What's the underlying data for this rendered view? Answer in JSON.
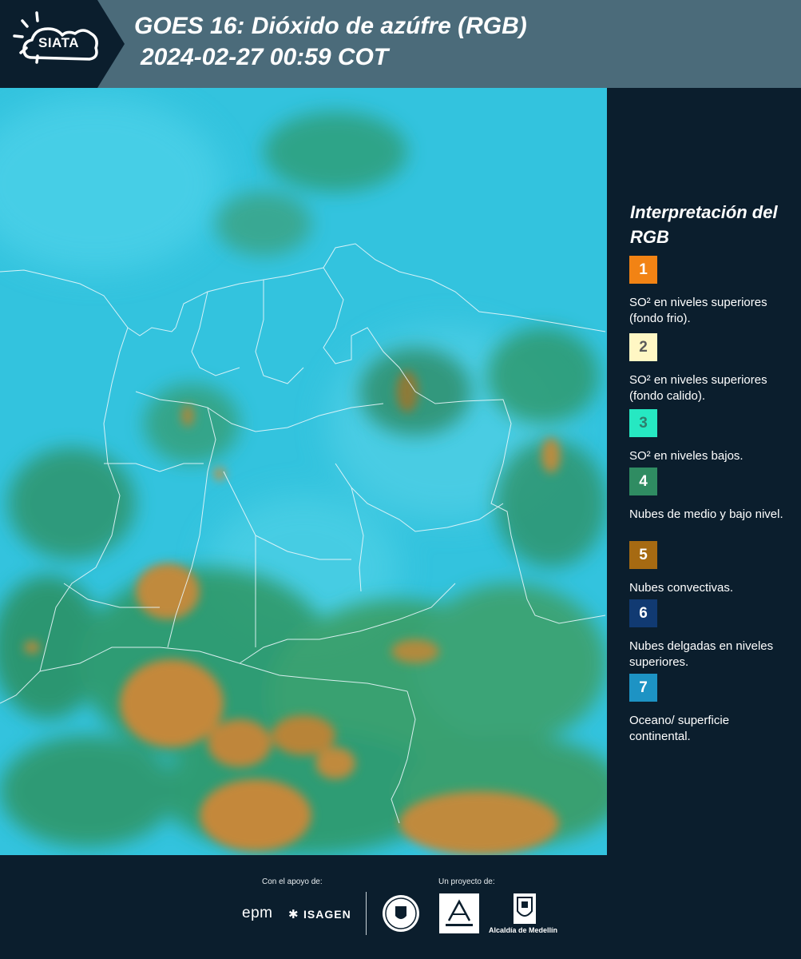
{
  "header": {
    "logo_text": "SIATA",
    "title_line1": "GOES 16: Dióxido de azúfre (RGB)",
    "title_line2": "2024-02-27 00:59 COT"
  },
  "legend": {
    "title": "Interpretación del RGB",
    "items": [
      {
        "number": "1",
        "label": "SO² en niveles superiores (fondo frio).",
        "color": "#f28314",
        "text_color": "#ffffff"
      },
      {
        "number": "2",
        "label": "SO² en niveles superiores (fondo calido).",
        "color": "#fff7c4",
        "text_color": "#5a5a5a"
      },
      {
        "number": "3",
        "label": "SO² en niveles bajos.",
        "color": "#26e8c2",
        "text_color": "#2f7c6c"
      },
      {
        "number": "4",
        "label": "Nubes de medio y bajo nivel.",
        "color": "#2f8c62",
        "text_color": "#ffffff"
      },
      {
        "number": "5",
        "label": "Nubes convectivas.",
        "color": "#a66a12",
        "text_color": "#ffffff"
      },
      {
        "number": "6",
        "label": "Nubes delgadas en niveles superiores.",
        "color": "#113a72",
        "text_color": "#ffffff"
      },
      {
        "number": "7",
        "label": "Oceano/ superficie continental.",
        "color": "#1d93c4",
        "text_color": "#ffffff"
      }
    ]
  },
  "footer": {
    "support_caption": "Con el apoyo de:",
    "project_caption": "Un proyecto de:",
    "sponsor_1": "epm",
    "sponsor_2": "ISAGEN",
    "partner_3": "Alcaldía de Medellín"
  }
}
